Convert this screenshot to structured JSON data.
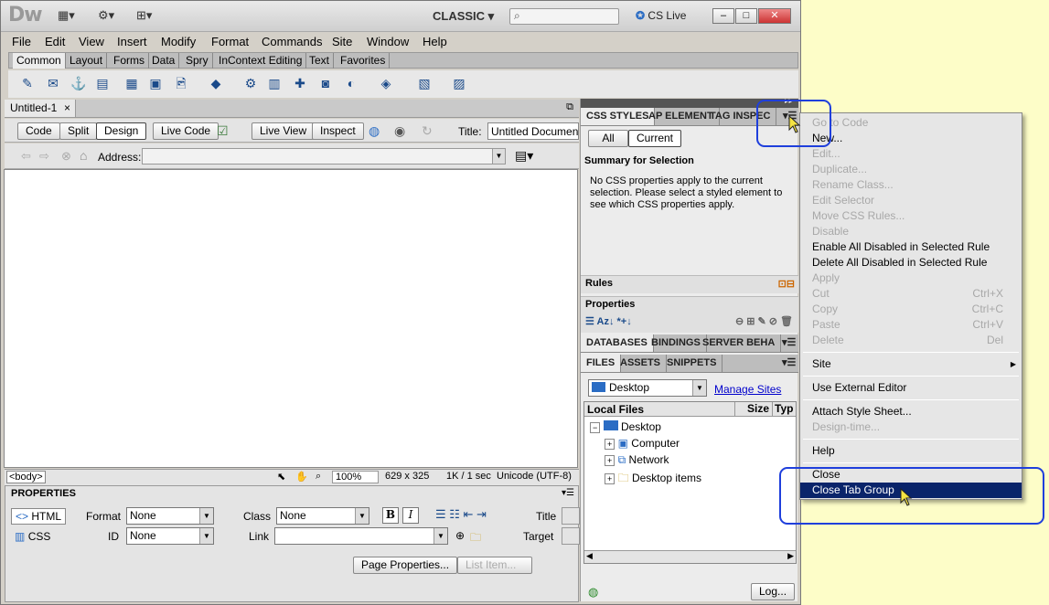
{
  "app": {
    "logo": "Dw",
    "workspace": "CLASSIC",
    "cslive": "CS Live",
    "min": "–",
    "max": "□",
    "close": "✕"
  },
  "menu": [
    "File",
    "Edit",
    "View",
    "Insert",
    "Modify",
    "Format",
    "Commands",
    "Site",
    "Window",
    "Help"
  ],
  "insert_tabs": [
    "Common",
    "Layout",
    "Forms",
    "Data",
    "Spry",
    "InContext Editing",
    "Text",
    "Favorites"
  ],
  "document": {
    "tab": "Untitled-1",
    "tab_close": "×",
    "views": [
      "Code",
      "Split",
      "Design"
    ],
    "live_code": "Live Code",
    "live_view": "Live View",
    "inspect": "Inspect",
    "title_label": "Title:",
    "title_value": "Untitled Document",
    "address_label": "Address:"
  },
  "status": {
    "tag": "<body>",
    "zoom": "100%",
    "size": "629 x 325",
    "weight": "1K / 1 sec",
    "encoding": "Unicode (UTF-8)"
  },
  "properties": {
    "header": "PROPERTIES",
    "html": "HTML",
    "css": "CSS",
    "format_label": "Format",
    "format_value": "None",
    "class_label": "Class",
    "class_value": "None",
    "id_label": "ID",
    "id_value": "None",
    "link_label": "Link",
    "title_label": "Title",
    "target_label": "Target",
    "page_props": "Page Properties...",
    "list_item": "List Item...",
    "bold": "B",
    "italic": "I"
  },
  "css_panel": {
    "tabs": [
      "CSS STYLES",
      "AP ELEMENT",
      "TAG INSPEC"
    ],
    "all": "All",
    "current": "Current",
    "summary": "Summary for Selection",
    "message": "No CSS properties apply to the current selection.  Please select a styled element to see which CSS properties apply.",
    "rules": "Rules",
    "properties": "Properties"
  },
  "db_panel": {
    "tabs": [
      "DATABASES",
      "BINDINGS",
      "SERVER BEHA"
    ]
  },
  "files_panel": {
    "tabs": [
      "FILES",
      "ASSETS",
      "SNIPPETS"
    ],
    "site": "Desktop",
    "manage": "Manage Sites",
    "col_local": "Local Files",
    "col_size": "Size",
    "col_type": "Typ",
    "tree": [
      {
        "label": "Desktop",
        "indent": 0,
        "toggle": "−"
      },
      {
        "label": "Computer",
        "indent": 1,
        "toggle": "+"
      },
      {
        "label": "Network",
        "indent": 1,
        "toggle": "+"
      },
      {
        "label": "Desktop items",
        "indent": 1,
        "toggle": "+"
      }
    ],
    "log": "Log..."
  },
  "context_menu": [
    {
      "label": "Go to Code",
      "disabled": true
    },
    {
      "label": "New...",
      "disabled": false
    },
    {
      "label": "Edit...",
      "disabled": true
    },
    {
      "label": "Duplicate...",
      "disabled": true
    },
    {
      "label": "Rename Class...",
      "disabled": true
    },
    {
      "label": "Edit Selector",
      "disabled": true
    },
    {
      "label": "Move CSS Rules...",
      "disabled": true
    },
    {
      "label": "Disable",
      "disabled": true
    },
    {
      "label": "Enable All Disabled in Selected Rule",
      "disabled": false
    },
    {
      "label": "Delete All Disabled in Selected Rule",
      "disabled": false
    },
    {
      "label": "Apply",
      "disabled": true
    },
    {
      "label": "Cut",
      "shortcut": "Ctrl+X",
      "disabled": true
    },
    {
      "label": "Copy",
      "shortcut": "Ctrl+C",
      "disabled": true
    },
    {
      "label": "Paste",
      "shortcut": "Ctrl+V",
      "disabled": true
    },
    {
      "label": "Delete",
      "shortcut": "Del",
      "disabled": true
    },
    {
      "sep": true
    },
    {
      "label": "Site",
      "submenu": true,
      "disabled": false
    },
    {
      "sep": true
    },
    {
      "label": "Use External Editor",
      "disabled": false
    },
    {
      "sep": true
    },
    {
      "label": "Attach Style Sheet...",
      "disabled": false
    },
    {
      "label": "Design-time...",
      "disabled": true
    },
    {
      "sep": true
    },
    {
      "label": "Help",
      "disabled": false
    },
    {
      "sep": true
    },
    {
      "label": "Close",
      "disabled": false
    },
    {
      "label": "Close Tab Group",
      "disabled": false,
      "highlighted": true
    }
  ],
  "colors": {
    "highlight": "#0a246a",
    "annotation": "#1f3fdc",
    "background": "#fdfdc8"
  }
}
